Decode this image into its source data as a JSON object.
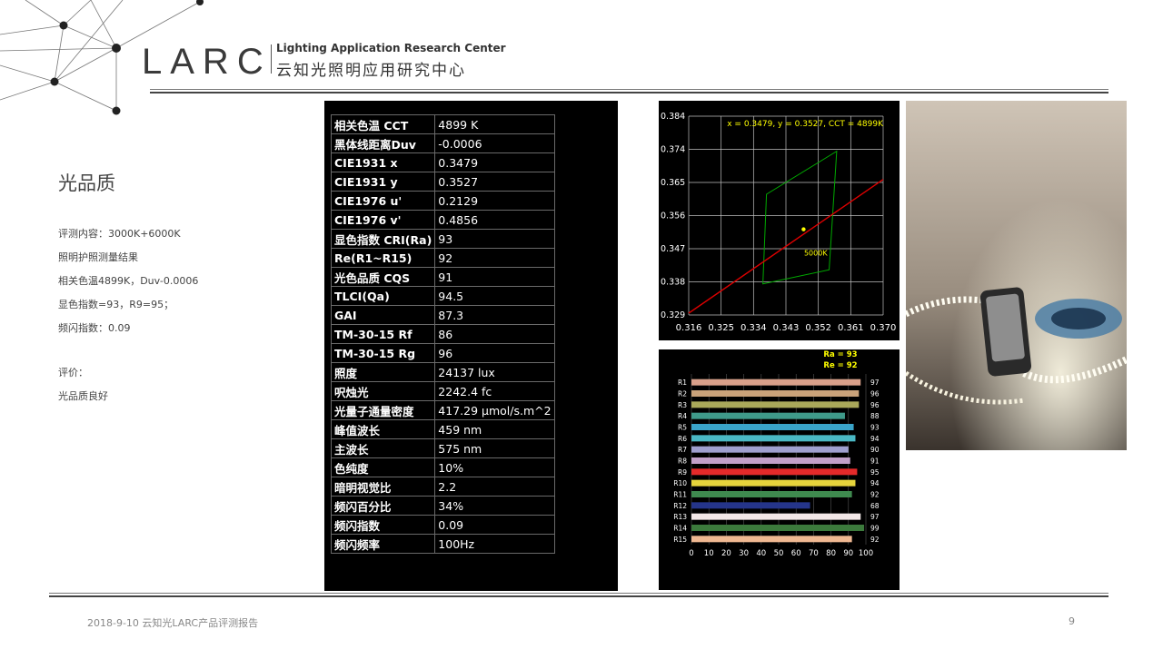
{
  "header": {
    "logo_mark": "LARC",
    "logo_en": "Lighting Application Research Center",
    "logo_cn": "云知光照明应用研究中心"
  },
  "slide": {
    "title": "光品质",
    "notes": [
      "评测内容：3000K+6000K",
      "照明护照测量结果",
      "相关色温4899K，Duv-0.0006",
      "显色指数=93，R9=95；",
      "频闪指数：0.09",
      "评价：",
      "光品质良好"
    ]
  },
  "measurements": [
    {
      "k": "相关色温 CCT",
      "v": "4899 K"
    },
    {
      "k": "黑体线距离Duv",
      "v": "-0.0006"
    },
    {
      "k": "CIE1931 x",
      "v": "0.3479"
    },
    {
      "k": "CIE1931 y",
      "v": "0.3527"
    },
    {
      "k": "CIE1976 u'",
      "v": "0.2129"
    },
    {
      "k": "CIE1976 v'",
      "v": "0.4856"
    },
    {
      "k": "显色指数 CRI(Ra)",
      "v": "93"
    },
    {
      "k": "Re(R1~R15)",
      "v": "92"
    },
    {
      "k": "光色品质 CQS",
      "v": "91"
    },
    {
      "k": "TLCI(Qa)",
      "v": "94.5"
    },
    {
      "k": "GAI",
      "v": "87.3"
    },
    {
      "k": "TM-30-15 Rf",
      "v": "86"
    },
    {
      "k": "TM-30-15 Rg",
      "v": "96"
    },
    {
      "k": "照度",
      "v": "24137 lux"
    },
    {
      "k": "呎烛光",
      "v": "2242.4 fc"
    },
    {
      "k": "光量子通量密度",
      "v": "417.29 μmol/s.m^2"
    },
    {
      "k": "峰值波长",
      "v": "459 nm"
    },
    {
      "k": "主波长",
      "v": "575 nm"
    },
    {
      "k": "色纯度",
      "v": "10%"
    },
    {
      "k": "暗明视觉比",
      "v": "2.2"
    },
    {
      "k": "频闪百分比",
      "v": "34%"
    },
    {
      "k": "频闪指数",
      "v": "0.09"
    },
    {
      "k": "频闪频率",
      "v": "100Hz"
    }
  ],
  "chart_data": [
    {
      "type": "scatter",
      "annotation": "x = 0.3479, y = 0.3527, CCT = 4899K",
      "point": {
        "x": 0.3479,
        "y": 0.3527
      },
      "point_color": "#ffff00",
      "region_label": "5000K",
      "region_color": "#00aa00",
      "planckian_color": "#dd0000",
      "planckian": [
        {
          "x": 0.316,
          "y": 0.3295
        },
        {
          "x": 0.37,
          "y": 0.3665
        }
      ],
      "region": [
        {
          "x": 0.3366,
          "y": 0.3376
        },
        {
          "x": 0.355,
          "y": 0.3415
        },
        {
          "x": 0.3571,
          "y": 0.3743
        },
        {
          "x": 0.3376,
          "y": 0.3624
        }
      ],
      "xlim": [
        0.316,
        0.37
      ],
      "ylim": [
        0.329,
        0.384
      ],
      "xticks": [
        "0.316",
        "0.325",
        "0.334",
        "0.343",
        "0.352",
        "0.361",
        "0.370"
      ],
      "yticks": [
        "0.384",
        "0.374",
        "0.365",
        "0.356",
        "0.347",
        "0.338",
        "0.329"
      ],
      "grid": true
    },
    {
      "type": "bar",
      "orientation": "horizontal",
      "annotations": [
        "Ra = 93",
        "Re = 92"
      ],
      "annotation_color": "#ffff00",
      "categories": [
        "R1",
        "R2",
        "R3",
        "R4",
        "R5",
        "R6",
        "R7",
        "R8",
        "R9",
        "R10",
        "R11",
        "R12",
        "R13",
        "R14",
        "R15"
      ],
      "values": [
        97,
        96,
        96,
        88,
        93,
        94,
        90,
        91,
        95,
        94,
        92,
        68,
        97,
        99,
        92
      ],
      "colors": [
        "#d9a08a",
        "#c9a27a",
        "#a9a85a",
        "#3f9a8a",
        "#3aa4c9",
        "#4ab8c4",
        "#9f9fcf",
        "#c2a0c9",
        "#e52a2a",
        "#e6d43c",
        "#3f8a4f",
        "#25358a",
        "#f3e8e8",
        "#3c7a3c",
        "#f0b892"
      ],
      "xlim": [
        0,
        100
      ],
      "xticks": [
        "0",
        "10",
        "20",
        "30",
        "40",
        "50",
        "60",
        "70",
        "80",
        "90",
        "100"
      ],
      "grid": true
    }
  ],
  "footer": {
    "date_and_report": "2018-9-10   云知光LARC产品评测报告",
    "page_number": "9"
  }
}
